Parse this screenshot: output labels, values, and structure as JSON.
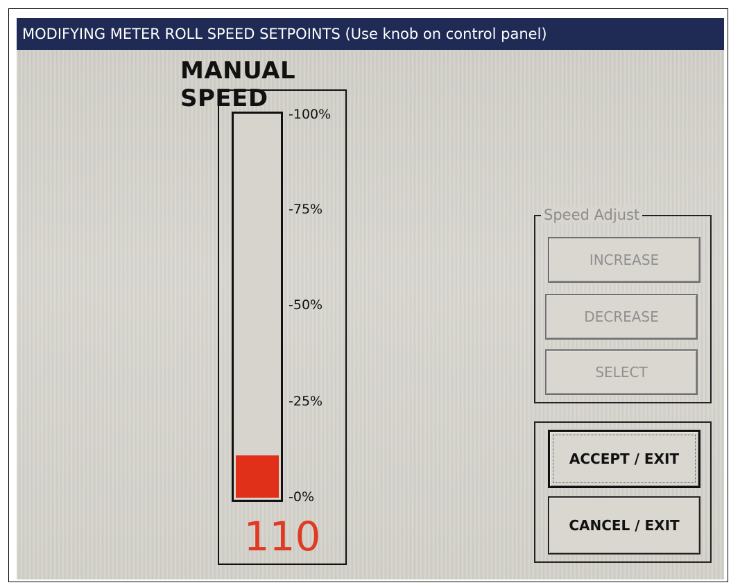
{
  "window": {
    "title": "MODIFYING METER ROLL SPEED SETPOINTS (Use knob on control panel)"
  },
  "meter": {
    "title": "MANUAL SPEED",
    "ticks": [
      "-100%",
      "-75%",
      "-50%",
      "-25%",
      "-0%"
    ],
    "value": "110",
    "fill_fraction": 0.11,
    "fill_color": "#e0301a",
    "value_color": "#e03a22"
  },
  "speed_adjust": {
    "legend": "Speed Adjust",
    "increase_label": "INCREASE",
    "decrease_label": "DECREASE",
    "select_label": "SELECT"
  },
  "exit": {
    "accept_label": "ACCEPT / EXIT",
    "cancel_label": "CANCEL / EXIT"
  },
  "colors": {
    "title_bar": "#1f2a55",
    "background": "#d6d4cd"
  }
}
